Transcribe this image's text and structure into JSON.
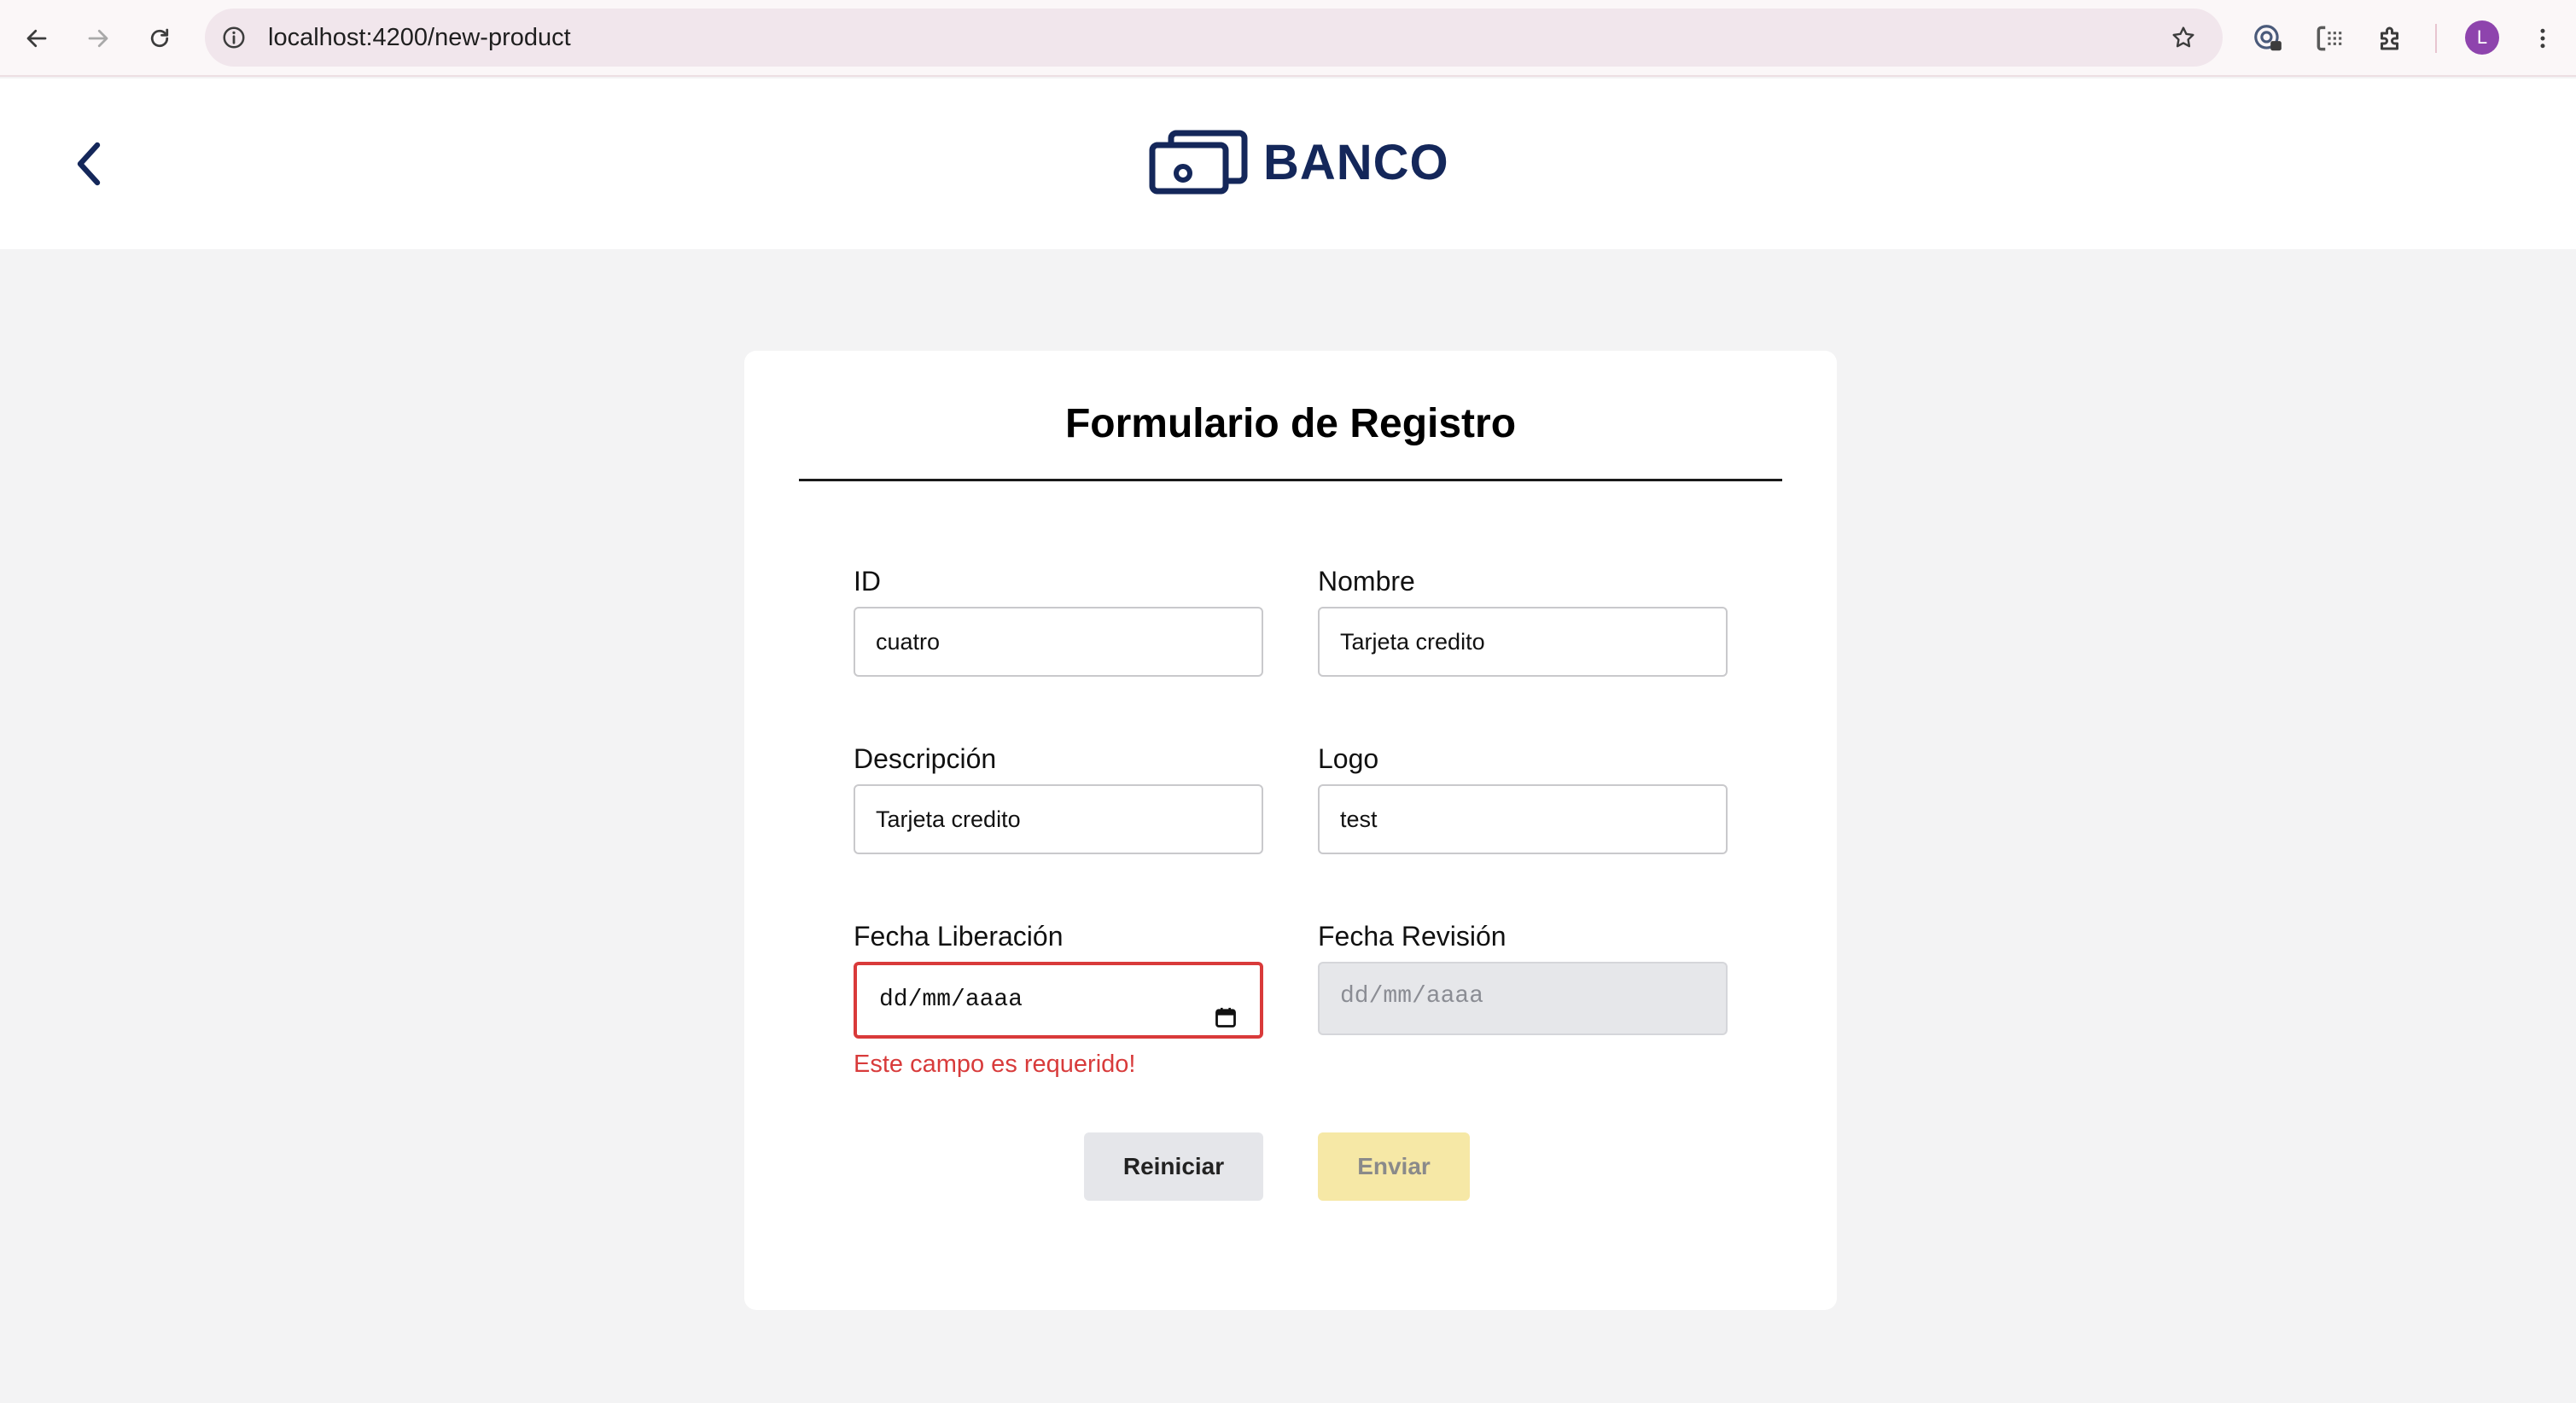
{
  "browser": {
    "url": "localhost:4200/new-product",
    "profile_initial": "L"
  },
  "header": {
    "brand": "BANCO",
    "brand_color": "#14275a"
  },
  "form": {
    "title": "Formulario de Registro",
    "fields": {
      "id": {
        "label": "ID",
        "value": "cuatro"
      },
      "nombre": {
        "label": "Nombre",
        "value": "Tarjeta credito"
      },
      "descripcion": {
        "label": "Descripción",
        "value": "Tarjeta credito"
      },
      "logo": {
        "label": "Logo",
        "value": "test"
      },
      "fecha_liberacion": {
        "label": "Fecha Liberación",
        "placeholder": "dd/mm/aaaa",
        "error": "Este campo es requerido!"
      },
      "fecha_revision": {
        "label": "Fecha Revisión",
        "placeholder": "dd/mm/aaaa"
      }
    },
    "buttons": {
      "reset": "Reiniciar",
      "submit": "Enviar"
    },
    "colors": {
      "error": "#d83b3b",
      "submit_disabled_bg": "#f6e8a6",
      "reset_bg": "#e5e6ea"
    }
  }
}
